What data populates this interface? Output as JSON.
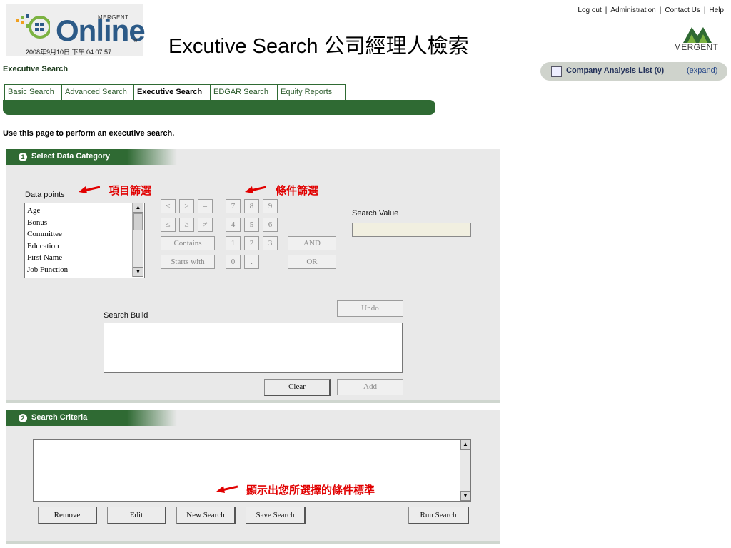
{
  "header": {
    "logo": {
      "small_brand": "MERGENT",
      "product": "Online",
      "tm": "TM",
      "datetime": "2008年9月10日 下午 04:07:57"
    },
    "title": "Excutive Search  公司經理人檢索",
    "top_links": [
      "Log out",
      "Administration",
      "Contact Us",
      "Help"
    ],
    "brand": "MERGENT"
  },
  "page_heading": "Executive Search",
  "analysis_list": {
    "label": "Company Analysis List (0)",
    "expand": "(expand)"
  },
  "tabs": [
    {
      "label": "Basic Search",
      "active": false
    },
    {
      "label": "Advanced Search",
      "active": false
    },
    {
      "label": "Executive Search",
      "active": true
    },
    {
      "label": "EDGAR Search",
      "active": false
    },
    {
      "label": "Equity Reports",
      "active": false
    }
  ],
  "instructions": "Use this page to perform an executive search.",
  "section1": {
    "number": "1",
    "title": "Select Data Category",
    "data_points_label": "Data points",
    "data_points": [
      "Age",
      "Bonus",
      "Committee",
      "Education",
      "First Name",
      "Job Function"
    ],
    "operators": {
      "row1": [
        "<",
        ">",
        "="
      ],
      "row2": [
        "≤",
        "≥",
        "≠"
      ],
      "contains": "Contains",
      "starts_with": "Starts with"
    },
    "keypad": {
      "row1": [
        "7",
        "8",
        "9"
      ],
      "row2": [
        "4",
        "5",
        "6"
      ],
      "row3": [
        "1",
        "2",
        "3"
      ],
      "row4": [
        "0",
        "."
      ]
    },
    "and_label": "AND",
    "or_label": "OR",
    "search_value_label": "Search Value",
    "search_build_label": "Search Build",
    "undo_label": "Undo",
    "clear_label": "Clear",
    "add_label": "Add"
  },
  "section2": {
    "number": "2",
    "title": "Search Criteria",
    "buttons": {
      "remove": "Remove",
      "edit": "Edit",
      "new_search": "New Search",
      "save_search": "Save Search",
      "run_search": "Run Search"
    }
  },
  "annotations": {
    "items_filter": "項目篩選",
    "condition_filter": "條件篩選",
    "shows_criteria": "顯示出您所選擇的條件標準"
  },
  "colors": {
    "brand_green": "#2f6a33",
    "annotation_red": "#e10000",
    "logo_blue": "#2c5a87"
  }
}
